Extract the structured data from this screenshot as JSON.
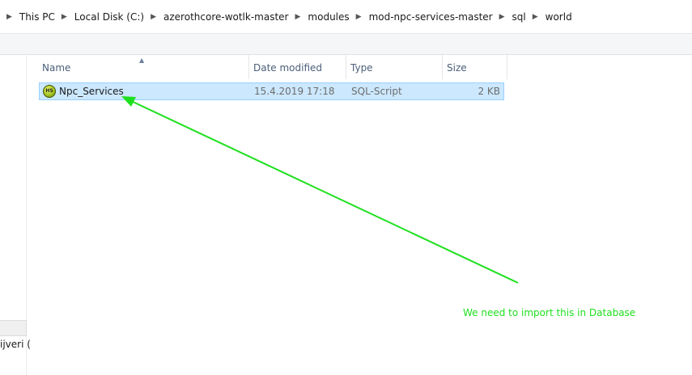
{
  "breadcrumb": {
    "items": [
      "This PC",
      "Local Disk (C:)",
      "azerothcore-wotlk-master",
      "modules",
      "mod-npc-services-master",
      "sql",
      "world"
    ]
  },
  "columns": {
    "name": "Name",
    "date_modified": "Date modified",
    "type": "Type",
    "size": "Size"
  },
  "files": [
    {
      "name": "Npc_Services",
      "icon": "sql-script-icon",
      "icon_text": "HS",
      "date_modified": "15.4.2019 17:18",
      "type": "SQL-Script",
      "size": "2 KB",
      "selected": true
    }
  ],
  "nav_pane": {
    "partial_label": "ijveri ("
  },
  "annotation": {
    "text": "We need to import this in Database",
    "color": "#1fe01f"
  },
  "colors": {
    "selection_bg": "#cce8ff",
    "selection_border": "#99d1ff",
    "header_text": "#4c607a"
  }
}
